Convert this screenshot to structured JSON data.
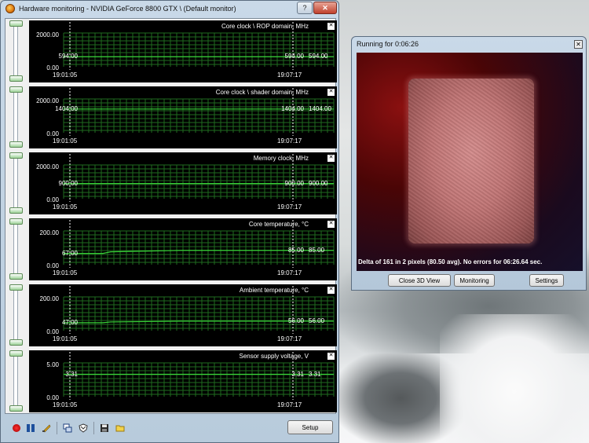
{
  "hw_window": {
    "title": "Hardware monitoring - NVIDIA GeForce 8800 GTX \\ (Default monitor)",
    "help_glyph": "?",
    "close_glyph": "✕",
    "setup_label": "Setup",
    "panels": [
      {
        "title": "Core clock \\ ROP domain, MHz",
        "ymax": "2000.00",
        "ymin": "0.00",
        "start_value": "594.00",
        "current_value": "594.00",
        "right_value": "594.00",
        "start_time": "19:01:05",
        "end_time": "19:07:17",
        "level": 0.297,
        "start_level": 0.297
      },
      {
        "title": "Core clock \\ shader domain, MHz",
        "ymax": "2000.00",
        "ymin": "0.00",
        "start_value": "1404.00",
        "current_value": "1404.00",
        "right_value": "1404.00",
        "start_time": "19:01:05",
        "end_time": "19:07:17",
        "level": 0.702,
        "start_level": 0.702
      },
      {
        "title": "Memory clock, MHz",
        "ymax": "2000.00",
        "ymin": "0.00",
        "start_value": "900.00",
        "current_value": "900.00",
        "right_value": "900.00",
        "start_time": "19:01:05",
        "end_time": "19:07:17",
        "level": 0.45,
        "start_level": 0.45
      },
      {
        "title": "Core temperature, °C",
        "ymax": "200.00",
        "ymin": "0.00",
        "start_value": "67.00",
        "current_value": "85.00",
        "right_value": "85.00",
        "start_time": "19:01:05",
        "end_time": "19:07:17",
        "level": 0.425,
        "start_level": 0.335
      },
      {
        "title": "Ambient temperature, °C",
        "ymax": "200.00",
        "ymin": "0.00",
        "start_value": "47.00",
        "current_value": "56.00",
        "right_value": "56.00",
        "start_time": "19:01:05",
        "end_time": "19:07:17",
        "level": 0.28,
        "start_level": 0.235
      },
      {
        "title": "Sensor supply voltage, V",
        "ymax": "5.00",
        "ymin": "0.00",
        "start_value": "3.31",
        "current_value": "3.31",
        "right_value": "3.31",
        "start_time": "19:01:05",
        "end_time": "19:07:17",
        "level": 0.662,
        "start_level": 0.662
      }
    ],
    "toolbar_icons": [
      "record-icon",
      "pause-icon",
      "log-icon",
      "windows-icon",
      "shield-icon",
      "save-icon",
      "open-folder-icon"
    ]
  },
  "render_window": {
    "title": "Running for 0:06:26",
    "close_glyph": "✕",
    "status": "Delta of 161 in 2 pixels (80.50 avg). No errors for 06:26.64 sec.",
    "buttons": {
      "close_3d": "Close 3D View",
      "monitoring": "Monitoring",
      "settings": "Settings"
    }
  },
  "colors": {
    "graph_bg": "#000000",
    "grid": "#1f6b1f",
    "line": "#38d338",
    "marker": "#ffffff"
  }
}
